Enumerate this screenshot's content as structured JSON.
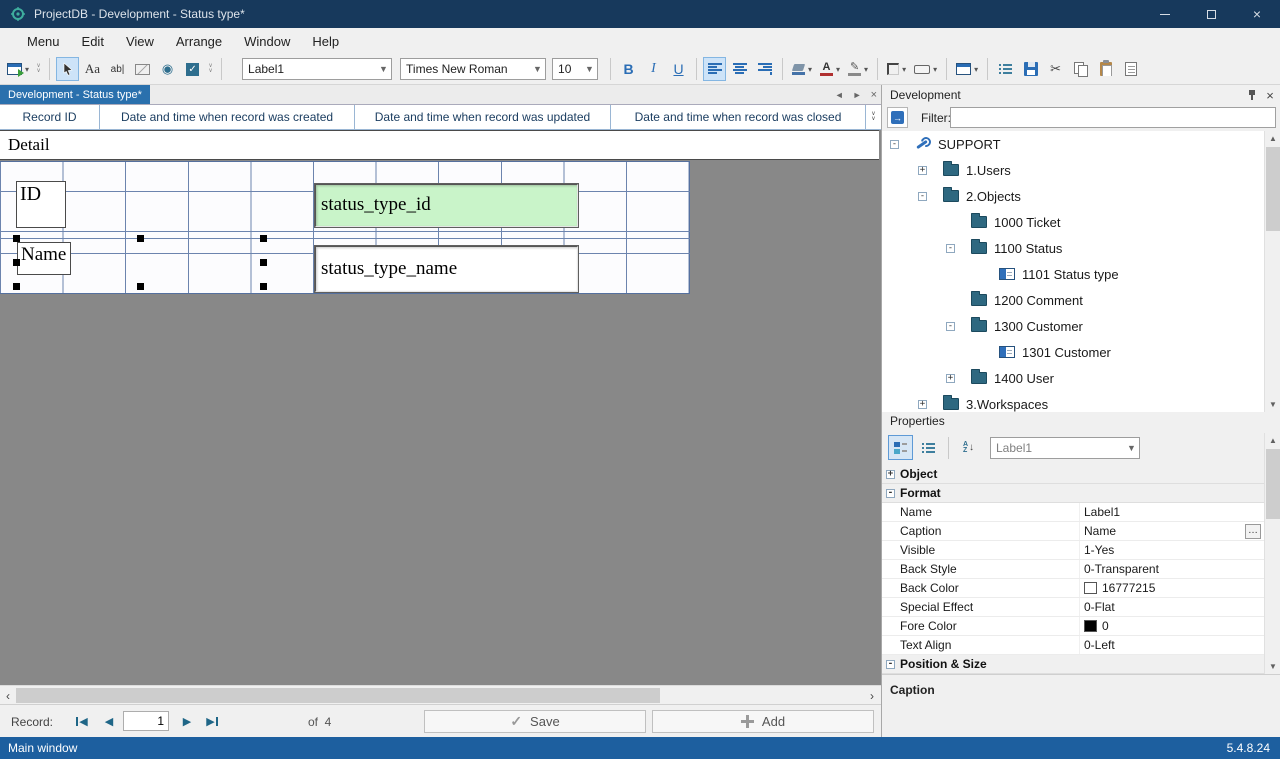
{
  "window": {
    "title": "ProjectDB - Development - Status type*",
    "status_left": "Main window",
    "status_right": "5.4.8.24"
  },
  "menu": [
    "Menu",
    "Edit",
    "View",
    "Arrange",
    "Window",
    "Help"
  ],
  "toolbar": {
    "object_selector": "Label1",
    "font_name": "Times New Roman",
    "font_size": "10",
    "bold": "B",
    "italic": "I",
    "underline": "U",
    "label_tool": "Aa",
    "textbox_tool": "ab|"
  },
  "tab": {
    "title": "Development - Status type*"
  },
  "datasheet": {
    "columns": [
      "Record ID",
      "Date and time when record was created",
      "Date and time when record was updated",
      "Date and time when record was closed"
    ]
  },
  "design": {
    "band_title": "Detail",
    "id_label": "ID",
    "id_field": "status_type_id",
    "name_label": "Name",
    "name_field": "status_type_name"
  },
  "development": {
    "title": "Development",
    "filter_label": "Filter:",
    "filter_value": "",
    "tree": [
      {
        "label": "SUPPORT"
      },
      {
        "label": "1.Users"
      },
      {
        "label": "2.Objects"
      },
      {
        "label": "1000 Ticket"
      },
      {
        "label": "1100 Status"
      },
      {
        "label": "1101 Status type"
      },
      {
        "label": "1200 Comment"
      },
      {
        "label": "1300 Customer"
      },
      {
        "label": "1301 Customer"
      },
      {
        "label": "1400 User"
      },
      {
        "label": "3.Workspaces"
      }
    ]
  },
  "properties": {
    "title": "Properties",
    "object_selector": "Label1",
    "categories": {
      "object": "Object",
      "format": "Format",
      "possize": "Position & Size"
    },
    "rows": [
      {
        "name": "Name",
        "value": "Label1"
      },
      {
        "name": "Caption",
        "value": "Name"
      },
      {
        "name": "Visible",
        "value": "1-Yes"
      },
      {
        "name": "Back Style",
        "value": "0-Transparent"
      },
      {
        "name": "Back Color",
        "value": "16777215",
        "swatch": "#ffffff"
      },
      {
        "name": "Special Effect",
        "value": "0-Flat"
      },
      {
        "name": "Fore Color",
        "value": "0",
        "swatch": "#000000"
      },
      {
        "name": "Text Align",
        "value": "0-Left"
      }
    ],
    "description_title": "Caption"
  },
  "record_bar": {
    "label": "Record:",
    "current": "1",
    "count_text": "of  4",
    "save": "Save",
    "add": "Add"
  },
  "colors": {
    "titlebar": "#17395c",
    "statusbar": "#1d5f9f",
    "tab_active": "#2a70ad",
    "field_green": "#c9f4c9",
    "accent_blue": "#2a6db5"
  }
}
